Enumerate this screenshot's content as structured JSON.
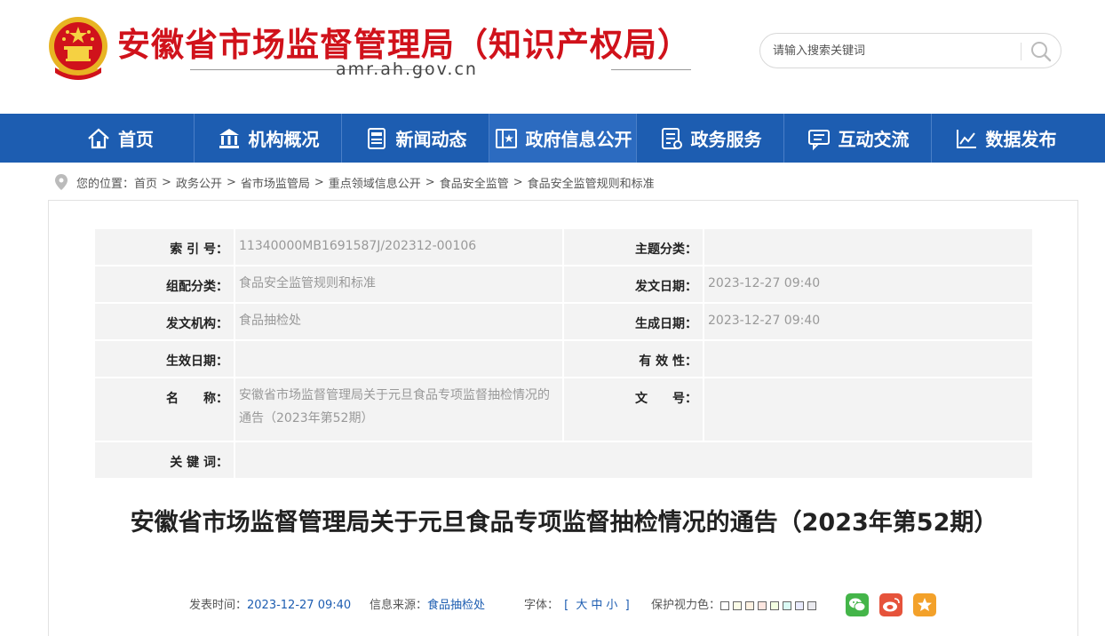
{
  "header": {
    "site_title": "安徽省市场监督管理局（知识产权局）",
    "domain": "amr.ah.gov.cn",
    "search_placeholder": "请输入搜索关键词"
  },
  "nav": {
    "items": [
      {
        "label": "首页",
        "icon": "home-icon"
      },
      {
        "label": "机构概况",
        "icon": "building-icon"
      },
      {
        "label": "新闻动态",
        "icon": "news-icon"
      },
      {
        "label": "政府信息公开",
        "icon": "book-icon"
      },
      {
        "label": "政务服务",
        "icon": "service-icon"
      },
      {
        "label": "互动交流",
        "icon": "chat-icon"
      },
      {
        "label": "数据发布",
        "icon": "chart-icon"
      }
    ],
    "active_index": 3
  },
  "breadcrumb": {
    "prefix": "您的位置：",
    "items": [
      "首页",
      "政务公开",
      "省市场监管局",
      "重点领域信息公开",
      "食品安全监管",
      "食品安全监管规则和标准"
    ],
    "separator": ">"
  },
  "meta": {
    "index_label": "索 引 号：",
    "index_value": "11340000MB1691587J/202312-00106",
    "topic_label": "主题分类：",
    "topic_value": "",
    "category_label": "组配分类：",
    "category_value": "食品安全监管规则和标准",
    "issue_date_label": "发文日期：",
    "issue_date_value": "2023-12-27 09:40",
    "org_label": "发文机构：",
    "org_value": "食品抽检处",
    "gen_date_label": "生成日期：",
    "gen_date_value": "2023-12-27 09:40",
    "effective_label": "生效日期：",
    "effective_value": "",
    "validity_label": "有 效 性：",
    "validity_value": "",
    "name_label": "名　　称：",
    "name_value": "安徽省市场监督管理局关于元旦食品专项监督抽检情况的通告（2023年第52期）",
    "doc_no_label": "文　　号：",
    "doc_no_value": "",
    "keywords_label": "关 键 词：",
    "keywords_value": ""
  },
  "article": {
    "title": "安徽省市场监督管理局关于元旦食品专项监督抽检情况的通告（2023年第52期）",
    "publish_label": "发表时间：",
    "publish_time": "2023-12-27 09:40",
    "source_label": "信息来源：",
    "source": "食品抽检处",
    "font_label": "字体：",
    "font_open": "[",
    "font_sizes": [
      "大",
      "中",
      "小"
    ],
    "font_close": "]",
    "eye_label": "保护视力色：",
    "eye_colors": [
      "#ffffff",
      "#fafbe6",
      "#fff2e2",
      "#fde6e0",
      "#f3ffe1",
      "#dafaf4",
      "#e9ebfe",
      "#eaeaef"
    ]
  },
  "share": {
    "items": [
      "wechat-icon",
      "weibo-icon",
      "star-icon"
    ]
  }
}
